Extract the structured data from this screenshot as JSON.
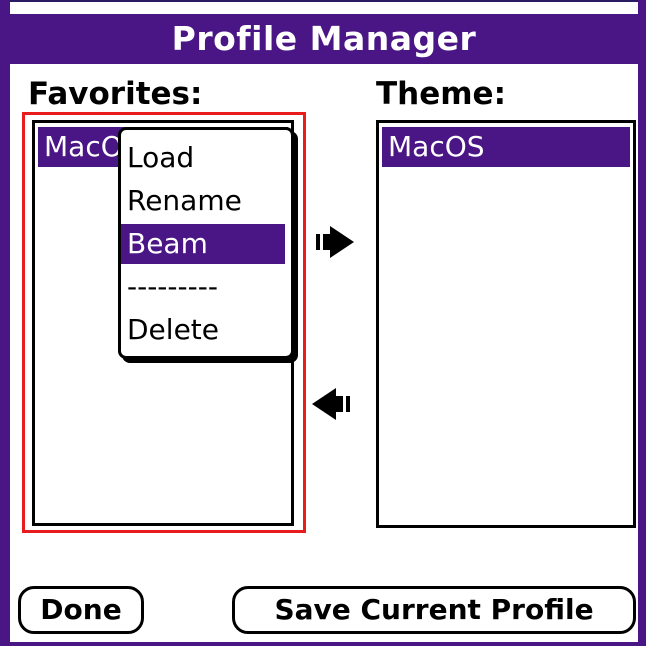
{
  "window": {
    "title": "Profile Manager"
  },
  "favorites": {
    "label": "Favorites:",
    "items": [
      {
        "label": "MacOS",
        "selected": true
      }
    ]
  },
  "theme": {
    "label": "Theme:",
    "items": [
      {
        "label": "MacOS",
        "selected": true
      }
    ]
  },
  "context_menu": {
    "items": [
      {
        "label": "Load"
      },
      {
        "label": "Rename"
      },
      {
        "label": "Beam",
        "selected": true
      },
      {
        "label": "---------"
      },
      {
        "label": "Delete"
      }
    ]
  },
  "arrows": {
    "to_theme": "arrow-right-icon",
    "to_favorites": "arrow-left-icon"
  },
  "buttons": {
    "done": "Done",
    "save": "Save Current Profile"
  },
  "colors": {
    "accent": "#4a1585",
    "selection_outline": "#e81c1c"
  }
}
